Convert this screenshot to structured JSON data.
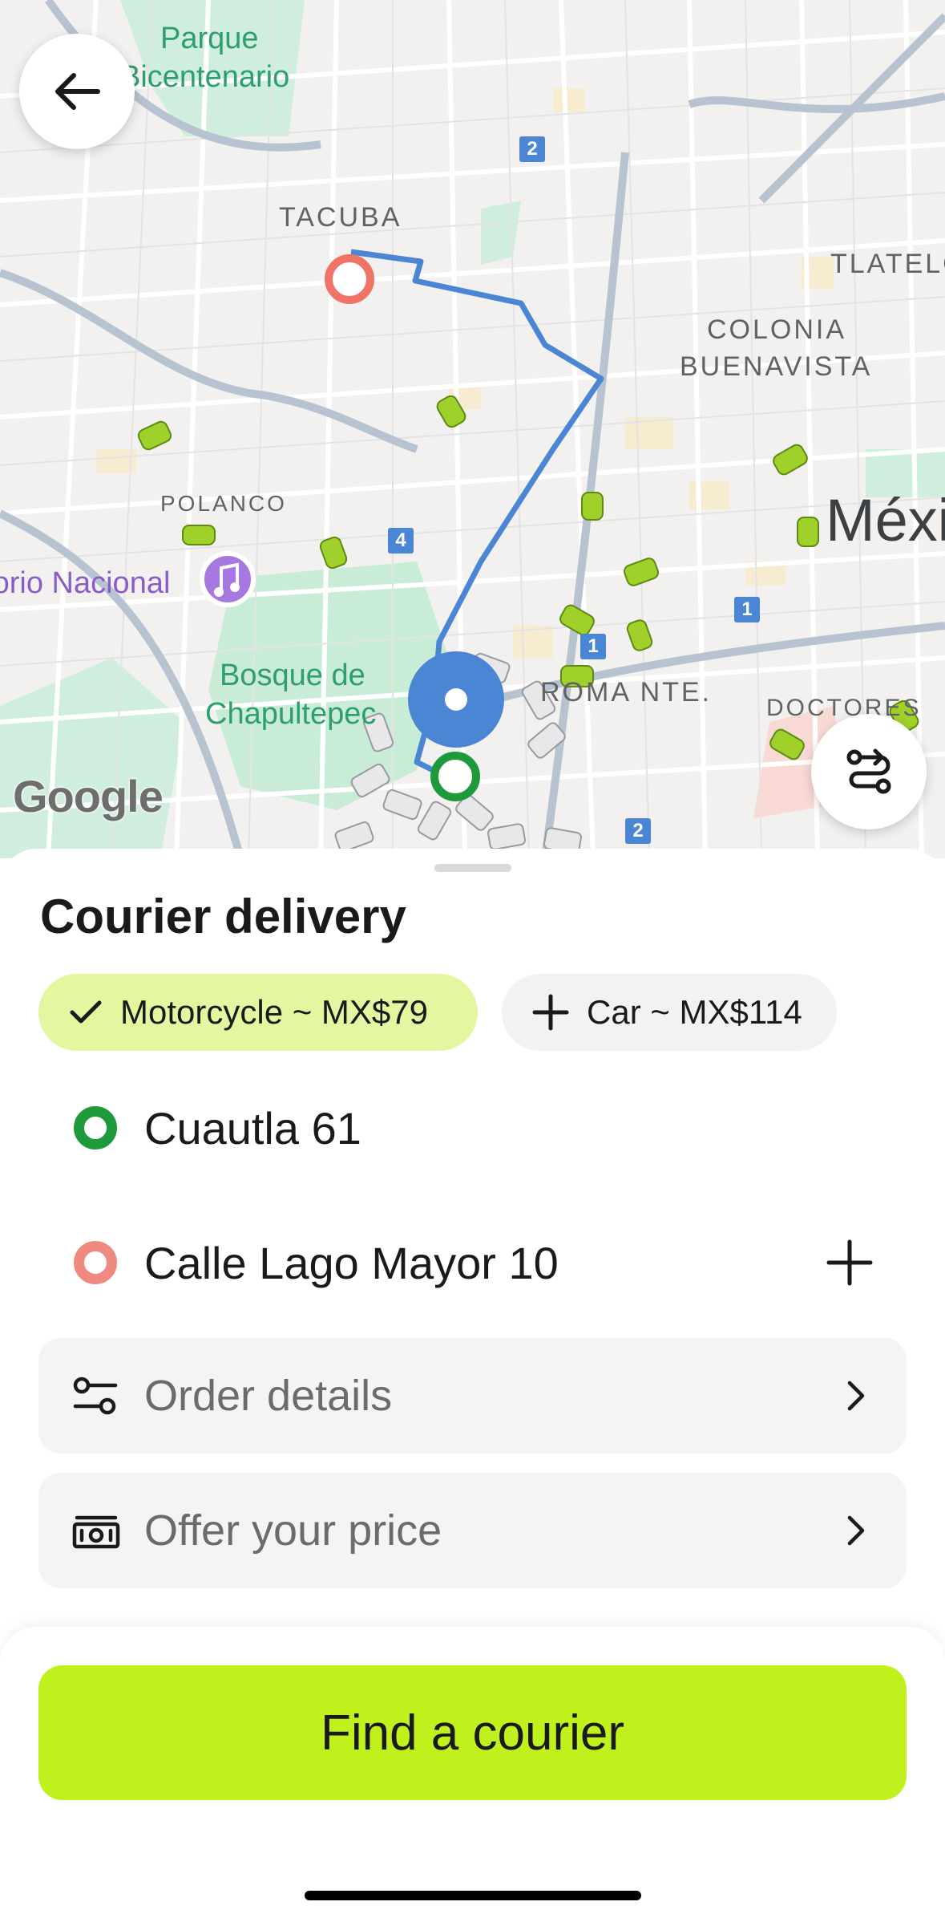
{
  "colors": {
    "accent": "#c1f11d",
    "selected_chip": "#e3f7a1",
    "route": "#4a86d4",
    "pickup_green": "#1e9a3a",
    "dropoff_red": "#f08a80"
  },
  "map": {
    "labels": {
      "parque": "Parque",
      "bicentenario": "Bicentenario",
      "tacuba": "TACUBA",
      "tlatelolco": "TLATELOLCO",
      "colonia": "COLONIA",
      "buenavista": "BUENAVISTA",
      "polanco": "POLANCO",
      "auditorio": "Auditorio Nacional",
      "bosque1": "Bosque de",
      "bosque2": "Chapultepec",
      "roma": "ROMA NTE.",
      "doctores": "DOCTORES",
      "mexico": "México"
    },
    "badges": [
      "2",
      "4",
      "1",
      "1",
      "2"
    ],
    "google_logo": "Google",
    "icons": {
      "back": "arrow-left-icon",
      "route_settings": "route-options-icon",
      "venue": "music-note-icon"
    }
  },
  "sheet": {
    "title": "Courier delivery",
    "options": [
      {
        "label": "Motorcycle ~ MX$79",
        "selected": true,
        "icon": "check-icon"
      },
      {
        "label": "Car ~ MX$114",
        "selected": false,
        "icon": "plus-icon"
      }
    ],
    "pickup": "Cuautla 61",
    "dropoff": "Calle Lago Mayor 10",
    "rows": [
      {
        "label": "Order details",
        "icon": "sliders-icon"
      },
      {
        "label": "Offer your price",
        "icon": "cash-icon"
      }
    ]
  },
  "footer": {
    "cta_label": "Find a courier"
  }
}
